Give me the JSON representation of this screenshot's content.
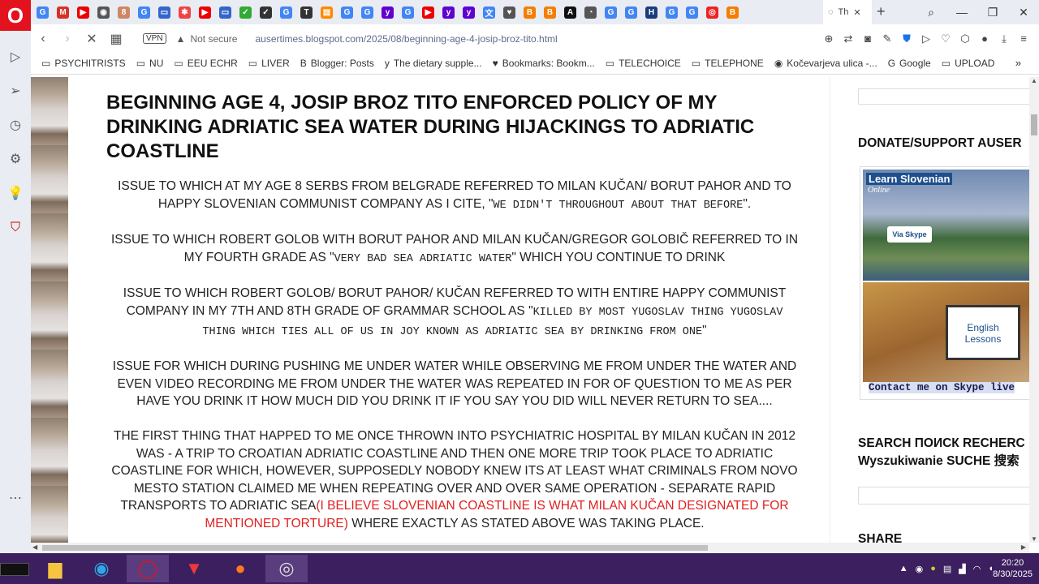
{
  "browser": {
    "logo": "O",
    "active_tab_label": "Th",
    "active_tab_close": "✕",
    "new_tab": "+",
    "window_controls": [
      "⌕",
      "—",
      "❐",
      "✕"
    ],
    "vpn_label": "VPN",
    "security_label": "Not secure",
    "url_domain": "ausertimes.blogspot.com",
    "url_path": "/2025/08/beginning-age-4-josip-broz-tito.html"
  },
  "tab_favicons": [
    {
      "letter": "G",
      "color": "#4285f4"
    },
    {
      "letter": "M",
      "color": "#d93025"
    },
    {
      "letter": "▶",
      "color": "#e00"
    },
    {
      "letter": "◉",
      "color": "#555"
    },
    {
      "letter": "8",
      "color": "#c86"
    },
    {
      "letter": "G",
      "color": "#4285f4"
    },
    {
      "letter": "▭",
      "color": "#36c"
    },
    {
      "letter": "✱",
      "color": "#e44"
    },
    {
      "letter": "▶",
      "color": "#e00"
    },
    {
      "letter": "▭",
      "color": "#36c"
    },
    {
      "letter": "✓",
      "color": "#3a3"
    },
    {
      "letter": "✓",
      "color": "#333"
    },
    {
      "letter": "G",
      "color": "#4285f4"
    },
    {
      "letter": "T",
      "color": "#333"
    },
    {
      "letter": "▤",
      "color": "#f80"
    },
    {
      "letter": "G",
      "color": "#4285f4"
    },
    {
      "letter": "G",
      "color": "#4285f4"
    },
    {
      "letter": "y",
      "color": "#6001d2"
    },
    {
      "letter": "G",
      "color": "#4285f4"
    },
    {
      "letter": "▶",
      "color": "#e00"
    },
    {
      "letter": "y",
      "color": "#6001d2"
    },
    {
      "letter": "y",
      "color": "#6001d2"
    },
    {
      "letter": "文",
      "color": "#4285f4"
    },
    {
      "letter": "♥",
      "color": "#555"
    },
    {
      "letter": "B",
      "color": "#f57d00"
    },
    {
      "letter": "B",
      "color": "#f57d00"
    },
    {
      "letter": "A",
      "color": "#111"
    },
    {
      "letter": "◔",
      "color": "#555"
    },
    {
      "letter": "G",
      "color": "#4285f4"
    },
    {
      "letter": "G",
      "color": "#4285f4"
    },
    {
      "letter": "H",
      "color": "#1a3d7c"
    },
    {
      "letter": "G",
      "color": "#4285f4"
    },
    {
      "letter": "G",
      "color": "#4285f4"
    },
    {
      "letter": "◎",
      "color": "#e22"
    },
    {
      "letter": "B",
      "color": "#f57d00"
    }
  ],
  "bookmarks": [
    {
      "icon": "▭",
      "label": "PSYCHITRISTS"
    },
    {
      "icon": "▭",
      "label": "NU"
    },
    {
      "icon": "▭",
      "label": "EEU ECHR"
    },
    {
      "icon": "▭",
      "label": "LIVER"
    },
    {
      "icon": "B",
      "label": "Blogger: Posts"
    },
    {
      "icon": "y",
      "label": "The dietary supple..."
    },
    {
      "icon": "♥",
      "label": "Bookmarks: Bookm..."
    },
    {
      "icon": "▭",
      "label": "TELECHOICE"
    },
    {
      "icon": "▭",
      "label": "TELEPHONE"
    },
    {
      "icon": "◉",
      "label": "Kočevarjeva ulica -..."
    },
    {
      "icon": "G",
      "label": "Google"
    },
    {
      "icon": "▭",
      "label": "UPLOAD"
    }
  ],
  "bookmarks_more": "»",
  "post": {
    "title": "BEGINNING AGE 4, JOSIP BROZ TITO ENFORCED POLICY OF MY DRINKING ADRIATIC SEA WATER DURING HIJACKINGS TO ADRIATIC COASTLINE",
    "p1a": "ISSUE TO WHICH AT MY AGE 8 SERBS FROM BELGRADE REFERRED TO MILAN KUČAN/ BORUT PAHOR AND TO HAPPY SLOVENIAN COMMUNIST COMPANY AS I CITE, \"",
    "p1mono": "WE DIDN'T THROUGHOUT ABOUT THAT BEFORE",
    "p1b": "\".",
    "p2a": "ISSUE TO WHICH ROBERT GOLOB WITH BORUT PAHOR AND MILAN KUČAN/GREGOR GOLOBIČ REFERRED TO IN MY FOURTH GRADE AS \"",
    "p2mono": "VERY BAD SEA ADRIATIC WATER",
    "p2b": "\" WHICH YOU CONTINUE TO DRINK",
    "p3a": "ISSUE TO WHICH ROBERT GOLOB/ BORUT PAHOR/ KUČAN REFERRED TO WITH ENTIRE HAPPY COMMUNIST COMPANY IN MY 7TH AND 8TH GRADE OF GRAMMAR SCHOOL AS \"",
    "p3mono": "KILLED BY MOST YUGOSLAV THING YUGOSLAV THING WHICH TIES ALL OF US IN JOY KNOWN AS  ADRIATIC SEA BY DRINKING FROM ONE",
    "p3b": "\"",
    "p4": "ISSUE FOR WHICH DURING PUSHING ME UNDER WATER WHILE OBSERVING ME FROM UNDER THE WATER AND EVEN VIDEO RECORDING ME FROM UNDER THE WATER WAS REPEATED IN FOR OF QUESTION TO ME AS PER HAVE YOU DRINK IT HOW MUCH DID YOU DRINK IT IF YOU SAY YOU DID WILL NEVER RETURN TO SEA....",
    "p5a": "THE FIRST THING THAT HAPPED TO ME ONCE THROWN INTO PSYCHIATRIC HOSPITAL BY MILAN KUČAN IN 2012 WAS - A TRIP TO CROATIAN ADRIATIC COASTLINE AND THEN ONE MORE TRIP TOOK PLACE TO ADRIATIC COASTLINE FOR WHICH, HOWEVER, SUPPOSEDLY NOBODY KNEW ITS AT LEAST WHAT CRIMINALS FROM NOVO MESTO STATION CLAIMED ME WHEN REPEATING OVER AND OVER SAME OPERATION - SEPARATE RAPID TRANSPORTS TO ADRIATIC SEA",
    "p5red": "(I BELIEVE SLOVENIAN COASTLINE IS WHAT MILAN KUČAN DESIGNATED FOR MENTIONED TORTURE)",
    "p5b": " WHERE EXACTLY AS STATED ABOVE WAS TAKING PLACE."
  },
  "sidebar_right": {
    "donate_title": "DONATE/SUPPORT AUSER",
    "ad_learn": "Learn Slovenian",
    "ad_online": "Online",
    "ad_skype": "Via Skype",
    "ad_english": "English Lessons",
    "ad_contact": "Contact me on Skype live",
    "search_title_line1": "SEARCH ПОИСК RECHERC",
    "search_title_line2": "Wyszukiwanie SUCHE 搜索",
    "share_title": "SHARE"
  },
  "taskbar": {
    "time": "20:20",
    "date": "8/30/2025"
  },
  "colors": {
    "accent_red": "#e02020",
    "taskbar": "#3b1f5e",
    "opera_red": "#e2131f"
  }
}
